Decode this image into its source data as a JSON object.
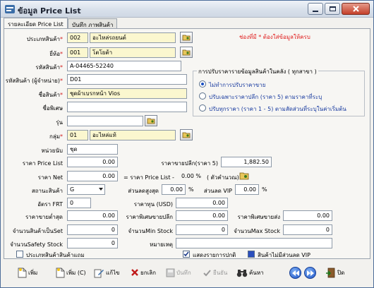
{
  "window": {
    "title": "ข้อมูล Price List"
  },
  "tabs": [
    {
      "label": "รายละเอียด Price List",
      "active": true
    },
    {
      "label": "บันทึก ภาพสินค้า",
      "active": false
    }
  ],
  "required_note": "ช่องที่มี * ต้องใส่ข้อมูลให้ครบ",
  "form": {
    "category": {
      "label": "ประเภทสินค้า",
      "code": "002",
      "name": "อะไหล่รถยนต์"
    },
    "brand": {
      "label": "ยี่ห้อ",
      "code": "001",
      "name": "โตโยต้า"
    },
    "product_code": {
      "label": "รหัสสินค้า",
      "value": "A-04465-52240"
    },
    "vendor_code": {
      "label": "รหัสสินค้า (ผู้จำหน่าย)",
      "value": "D01"
    },
    "product_name": {
      "label": "ชื่อสินค้า",
      "value": "ชุดผ้าเบรกหน้า Vios"
    },
    "special_name": {
      "label": "ชื่อพิเศษ",
      "value": ""
    },
    "model": {
      "label": "รุ่น",
      "value": ""
    },
    "group": {
      "label": "กลุ่ม",
      "code": "01",
      "name": "อะไหล่แท้"
    },
    "unit": {
      "label": "หน่วยนับ",
      "value": "ชุด"
    },
    "list_price": {
      "label": "ราคา Price List",
      "value": "0.00"
    },
    "retail_price": {
      "label": "ราคาขายปลีก(ราคา 5)",
      "value": "1,882.50"
    },
    "net_price": {
      "label": "ราคา Net",
      "value": "0.00"
    },
    "net_formula": {
      "text": "= ราคา Price List -",
      "percent": "0.00 %",
      "suffix": "( ตัวคำนวณ)"
    },
    "status": {
      "label": "สถานะสินค้า",
      "value": "G"
    },
    "max_discount": {
      "label": "ส่วนลดสูงสุด",
      "value": "0.00",
      "unit": "%"
    },
    "vip_discount": {
      "label": "ส่วนลด VIP",
      "value": "0.00",
      "unit": "%"
    },
    "frt_rate": {
      "label": "อัตรา FRT",
      "value": "0"
    },
    "cost_usd": {
      "label": "ราคาทุน (USD)",
      "value": "0.00"
    },
    "min_sale_price": {
      "label": "ราคาขายต่ำสุด",
      "value": "0.00"
    },
    "special_retail": {
      "label": "ราคาพิเศษขายปลีก",
      "value": "0.00"
    },
    "special_wholesale": {
      "label": "ราคาพิเศษขายส่ง",
      "value": "0.00"
    },
    "qty_per_set": {
      "label": "จำนวนสินค้าเป็นSet",
      "value": "0"
    },
    "min_stock": {
      "label": "จำนวนMin Stock",
      "value": "0"
    },
    "max_stock": {
      "label": "จำนวนMax Stock",
      "value": "0"
    },
    "safety_stock": {
      "label": "จำนวนSafety Stock",
      "value": "0"
    },
    "remark": {
      "label": "หมายเหตุ",
      "value": ""
    }
  },
  "price_adjust": {
    "title": "การปรับราคารายข้อมูลสินค้าในคลัง ( ทุกสาขา )",
    "options": [
      {
        "label": "ไม่ทำการปรับราคาขาย",
        "selected": true
      },
      {
        "label": "ปรับเฉพาะราคาปลีก (ราคา 5) ตามราคาที่ระบุ",
        "selected": false
      },
      {
        "label": "ปรับทุกราคา (ราคา 1 - 5) ตามสัดส่วนที่ระบุในค่าเริ่มต้น",
        "selected": false
      }
    ]
  },
  "checkboxes": {
    "gift_type": {
      "label": "ประเภทสินค้าสินค้าแถม",
      "checked": false
    },
    "show_normal": {
      "label": "แสดงรายการปกติ",
      "checked": true
    },
    "no_vip": {
      "label": "สินค้าไม่มีส่วนลด VIP",
      "checked": true
    }
  },
  "toolbar": {
    "add": "เพิ่ม",
    "add_copy": "เพิ่ม (C)",
    "edit": "แก้ไข",
    "cancel": "ยกเลิก",
    "save": "บันทึก",
    "confirm": "ยืนยัน",
    "search": "ค้นหา",
    "close": "ปิด"
  },
  "colors": {
    "required_text": "#e01f1f",
    "required_field_bg": "#fbf7cf",
    "radio_text": "#1a3ca0"
  }
}
